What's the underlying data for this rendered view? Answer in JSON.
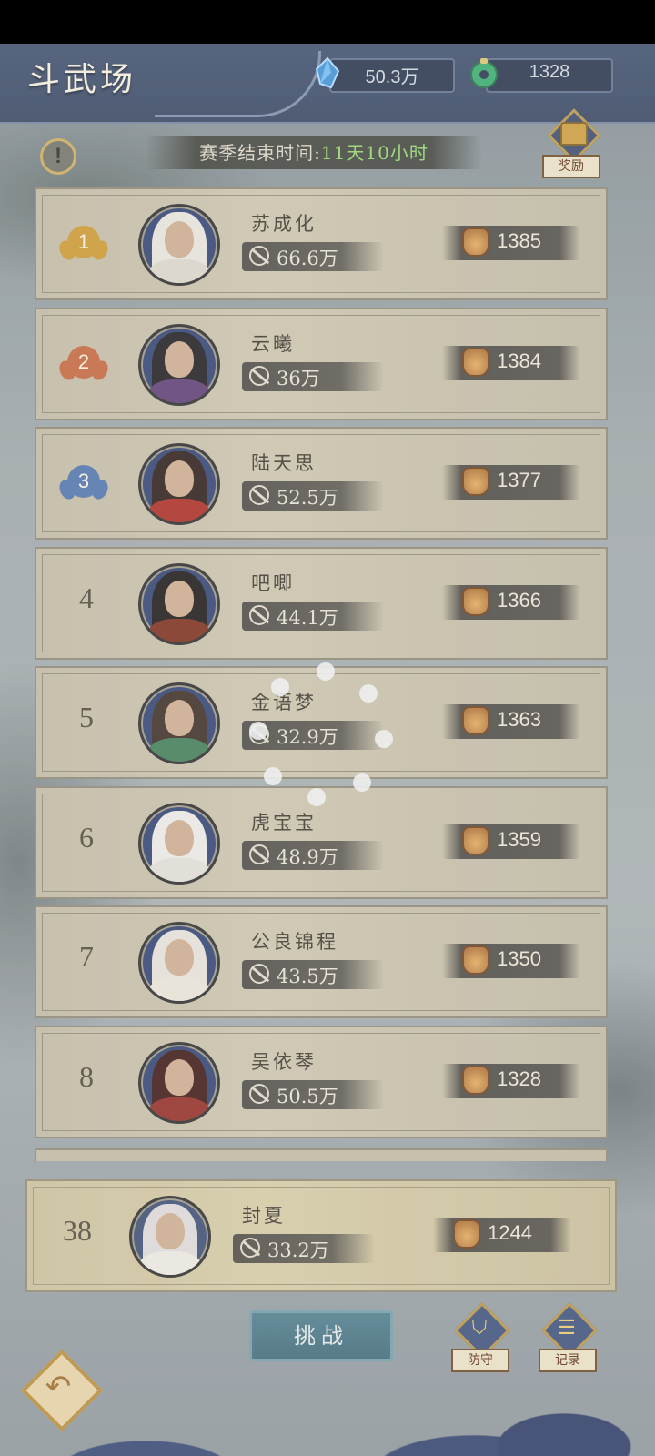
{
  "header": {
    "title": "斗武场",
    "crystals": "50.3万",
    "jade": "1328",
    "crystal_color": "#3c8fd0",
    "jade_color": "#35a86a"
  },
  "season": {
    "label": "赛季结束时间:",
    "remaining": "11天10小时"
  },
  "reward_button": {
    "label": "奖励"
  },
  "ranking": [
    {
      "rank": "1",
      "name": "苏成化",
      "power": "66.6万",
      "score": "1385",
      "medal_color": "#c8952e"
    },
    {
      "rank": "2",
      "name": "云曦",
      "power": "36万",
      "score": "1384",
      "medal_color": "#c0643a"
    },
    {
      "rank": "3",
      "name": "陆天思",
      "power": "52.5万",
      "score": "1377",
      "medal_color": "#4f72a8"
    },
    {
      "rank": "4",
      "name": "吧唧",
      "power": "44.1万",
      "score": "1366"
    },
    {
      "rank": "5",
      "name": "金语梦",
      "power": "32.9万",
      "score": "1363"
    },
    {
      "rank": "6",
      "name": "虎宝宝",
      "power": "48.9万",
      "score": "1359"
    },
    {
      "rank": "7",
      "name": "公良锦程",
      "power": "43.5万",
      "score": "1350"
    },
    {
      "rank": "8",
      "name": "吴依琴",
      "power": "50.5万",
      "score": "1328"
    }
  ],
  "my_rank": {
    "rank": "38",
    "name": "封夏",
    "power": "33.2万",
    "score": "1244"
  },
  "actions": {
    "challenge": "挑战",
    "defense": "防守",
    "record": "记录"
  },
  "icons": {
    "info": "info-icon",
    "power": "power-icon",
    "score": "score-icon",
    "back": "back-icon",
    "loading": "loading-spinner"
  }
}
